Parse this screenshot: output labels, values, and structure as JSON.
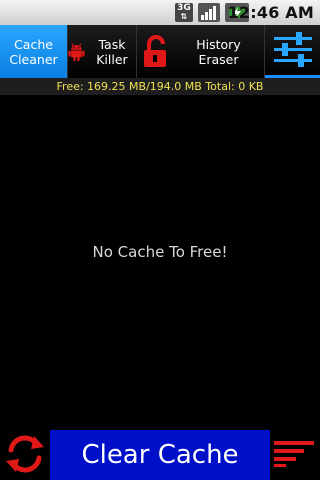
{
  "status_bar": {
    "network_label": "3G",
    "time": "12:46 AM"
  },
  "tabs": [
    {
      "label": "Cache\nCleaner",
      "active": true,
      "icon": null
    },
    {
      "label": "Task Killer",
      "active": false,
      "icon": "android-robot-icon"
    },
    {
      "label": "History\nEraser",
      "active": false,
      "icon": "padlock-icon"
    },
    {
      "label": "",
      "active": false,
      "icon": "sliders-icon"
    }
  ],
  "info_bar": {
    "text": "Free: 169.25 MB/194.0 MB  Total:  0 KB"
  },
  "main": {
    "empty_message": "No Cache To Free!"
  },
  "bottom": {
    "clear_button_label": "Clear Cache",
    "refresh_icon": "refresh-icon",
    "menu_icon": "menu-lines-icon"
  },
  "colors": {
    "active_tab": "#1a8cff",
    "clear_button": "#0010c8",
    "info_text": "#f0e050",
    "red_icon": "#e01818"
  }
}
